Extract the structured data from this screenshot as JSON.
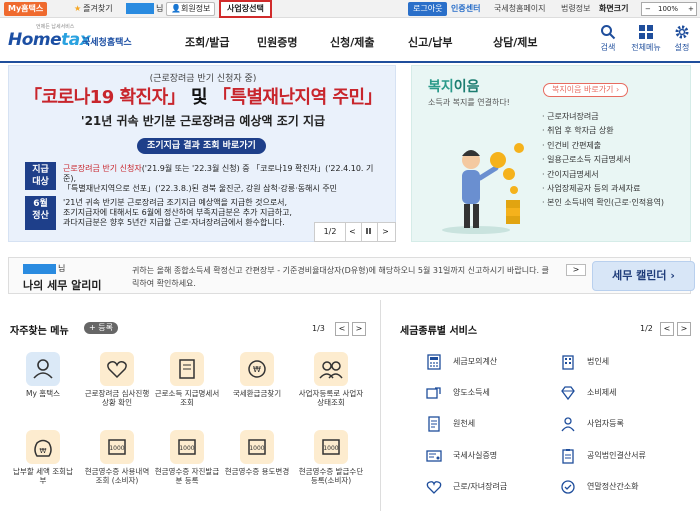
{
  "topbar": {
    "myhome": "My홈택스",
    "favorites": "즐겨찾기",
    "nim": "님",
    "member_info": "회원정보",
    "biz_select": "사업장선택",
    "logout": "로그아웃",
    "cert_center": "인증센터",
    "links": [
      "국세청홈페이지",
      "법령정보",
      "화면크기"
    ],
    "zoom": "100%"
  },
  "header": {
    "logo_tag": "언제든 납세서비스",
    "logo_main_a": "Home",
    "logo_main_b": "tax",
    "logo_sub": "국세청홈택스",
    "nav": [
      "조회/발급",
      "민원증명",
      "신청/제출",
      "신고/납부",
      "상담/제보"
    ],
    "icons": [
      {
        "label": "검색",
        "icon": "search-icon"
      },
      {
        "label": "전체메뉴",
        "icon": "grid-icon"
      },
      {
        "label": "설정",
        "icon": "gear-icon"
      }
    ]
  },
  "banner": {
    "sub1": "(근로장려금 반기 신청자 중)",
    "title_a": "「코로나19 확진자」",
    "title_b": " 및 ",
    "title_c": "「특별재난지역 주민」",
    "sub2": "'21년 귀속 반기분 근로장려금 예상액 조기 지급",
    "cta": "조기지급 결과 조회 바로가기",
    "rows": [
      {
        "label": "지급\n대상",
        "text_a": "근로장려금 반기 신청자",
        "text_b": "('21.9월 또는 '22.3월 신청) 중 「코로나19 확진자」('22.4.10. 기준),",
        "text_c": "「특별재난지역으로 선포」('22.3.8.)된 경북 울진군, 강원 삼척·강릉·동해시 주민"
      },
      {
        "label": "6월\n정산",
        "text_a": "'21년 귀속 반기분 근로장려금 조기지급 예상액을 지급한 것으로서,",
        "text_b": "조기지급자에 대해서도 6월에 정산하여 부족지급분은 추가 지급하고,",
        "text_c": "과다지급분은 향후 5년간 지급할 근로·자녀장려금에서 환수합니다."
      }
    ],
    "pager": {
      "current": "1/2",
      "prev": "<",
      "pause": "II",
      "next": ">"
    }
  },
  "welfare": {
    "title_a": "복지",
    "title_b": "이음",
    "desc": "소득과 복지를 연결하다!",
    "link": "복지이음 바로가기",
    "items": [
      "근로자녀장려금",
      "취업 후 학자금 상환",
      "인건비 간편제출",
      "일용근로소득 지급명세서",
      "간이지급명세서",
      "사업장제공자 등의 과세자료",
      "본인 소득내역 확인(근로·인적용역)"
    ]
  },
  "calendar": {
    "nim": "님",
    "title": "나의 세무 알리미",
    "message": "귀하는 올해 종합소득세 확정신고 간편장부 - 기준경비율대상자(D유형)에 해당하오니 5월 31일까지 신고하시기 바랍니다. 클릭하여 확인하세요.",
    "arrow": ">",
    "button": "세무 캘린더"
  },
  "favorites_menu": {
    "title": "자주찾는 메뉴",
    "add": "+ 등록",
    "page": "1/3",
    "prev": "<",
    "next": ">",
    "items": [
      {
        "label": "My 홈택스",
        "icon": "user-icon"
      },
      {
        "label": "근로장려금 심사진행상황 확인",
        "icon": "heart-icon"
      },
      {
        "label": "근로소득 지급명세서 조회",
        "icon": "document-icon"
      },
      {
        "label": "국세환급금찾기",
        "icon": "refund-icon"
      },
      {
        "label": "사업자등록로 사업자상태조회",
        "icon": "people-icon"
      },
      {
        "label": "납부할 세액 조회납부",
        "icon": "money-bag-icon"
      },
      {
        "label": "현금영수증 사용내역조회 (소비자)",
        "icon": "receipt-icon"
      },
      {
        "label": "현금영수증 자진발급분 등록",
        "icon": "receipt-icon"
      },
      {
        "label": "현금영수증 용도변경",
        "icon": "receipt-icon"
      },
      {
        "label": "현금영수증 발급수단 등록(소비자)",
        "icon": "receipt-icon"
      }
    ]
  },
  "tax_service": {
    "title": "세금종류별 서비스",
    "page": "1/2",
    "prev": "<",
    "next": ">",
    "items": [
      {
        "label": "세금모의계산",
        "icon": "calculator-icon"
      },
      {
        "label": "법인세",
        "icon": "building-icon"
      },
      {
        "label": "양도소득세",
        "icon": "transfer-icon"
      },
      {
        "label": "소비제세",
        "icon": "diamond-icon"
      },
      {
        "label": "원천세",
        "icon": "document-icon"
      },
      {
        "label": "사업자등록",
        "icon": "person-icon"
      },
      {
        "label": "국세사실증명",
        "icon": "certificate-icon"
      },
      {
        "label": "공익법인결산서류",
        "icon": "clipboard-icon"
      },
      {
        "label": "근로/자녀장려금",
        "icon": "heart-icon"
      },
      {
        "label": "연말정산간소화",
        "icon": "receipt-icon"
      }
    ]
  },
  "colors": {
    "brand_blue": "#1f4e9c",
    "accent_red": "#c8252c",
    "welfare_teal": "#2a9a8a",
    "myhome_orange": "#ef6a2e"
  }
}
